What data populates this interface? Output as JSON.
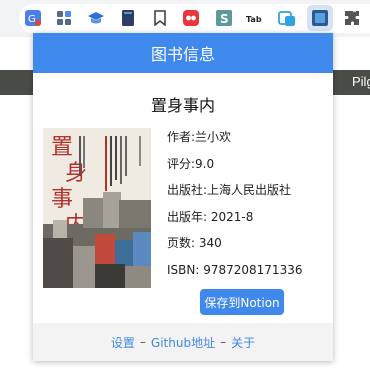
{
  "popup": {
    "header_title": "图书信息",
    "book_title": "置身事内",
    "fields": {
      "author": "作者:兰小欢",
      "rating": "评分:9.0",
      "publisher": "出版社:上海人民出版社",
      "pub_year": "出版年: 2021-8",
      "pages": "页数: 340",
      "isbn": "ISBN: 9787208171336"
    },
    "save_button": "保存到Notion",
    "footer": {
      "settings": "设置",
      "sep1": "–",
      "github": "Github地址",
      "sep2": "–",
      "about": "关于"
    }
  },
  "background_page": {
    "right_text": "Pilg"
  },
  "cover_art": {
    "title_chars": [
      "置",
      "身",
      "事",
      "内"
    ],
    "red": "#b5322b"
  },
  "colors": {
    "accent": "#3f88ec",
    "footer_bg": "#f3f3f3",
    "toolbar_bg": "#f1f3f4"
  }
}
